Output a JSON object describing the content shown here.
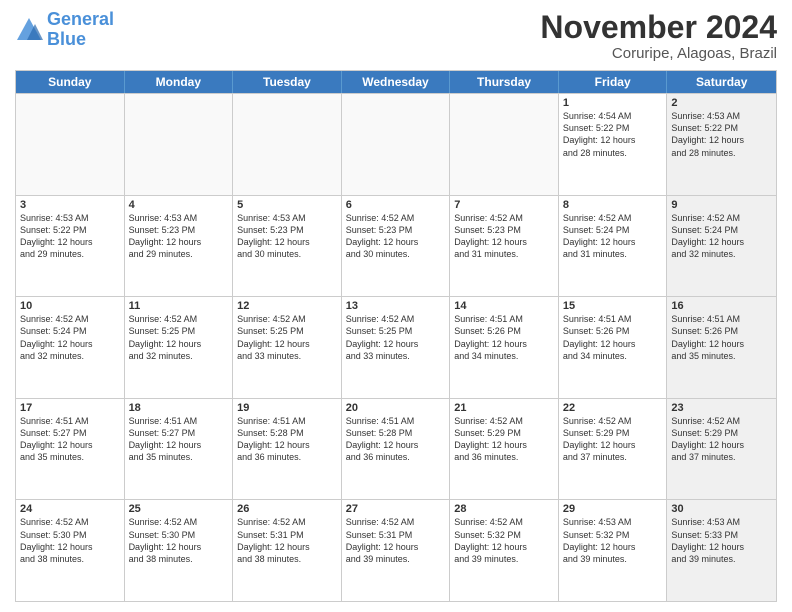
{
  "logo": {
    "line1": "General",
    "line2": "Blue"
  },
  "title": "November 2024",
  "location": "Coruripe, Alagoas, Brazil",
  "weekdays": [
    "Sunday",
    "Monday",
    "Tuesday",
    "Wednesday",
    "Thursday",
    "Friday",
    "Saturday"
  ],
  "rows": [
    [
      {
        "num": "",
        "info": "",
        "empty": true
      },
      {
        "num": "",
        "info": "",
        "empty": true
      },
      {
        "num": "",
        "info": "",
        "empty": true
      },
      {
        "num": "",
        "info": "",
        "empty": true
      },
      {
        "num": "",
        "info": "",
        "empty": true
      },
      {
        "num": "1",
        "info": "Sunrise: 4:54 AM\nSunset: 5:22 PM\nDaylight: 12 hours\nand 28 minutes.",
        "shade": false
      },
      {
        "num": "2",
        "info": "Sunrise: 4:53 AM\nSunset: 5:22 PM\nDaylight: 12 hours\nand 28 minutes.",
        "shade": true
      }
    ],
    [
      {
        "num": "3",
        "info": "Sunrise: 4:53 AM\nSunset: 5:22 PM\nDaylight: 12 hours\nand 29 minutes.",
        "shade": false
      },
      {
        "num": "4",
        "info": "Sunrise: 4:53 AM\nSunset: 5:23 PM\nDaylight: 12 hours\nand 29 minutes.",
        "shade": false
      },
      {
        "num": "5",
        "info": "Sunrise: 4:53 AM\nSunset: 5:23 PM\nDaylight: 12 hours\nand 30 minutes.",
        "shade": false
      },
      {
        "num": "6",
        "info": "Sunrise: 4:52 AM\nSunset: 5:23 PM\nDaylight: 12 hours\nand 30 minutes.",
        "shade": false
      },
      {
        "num": "7",
        "info": "Sunrise: 4:52 AM\nSunset: 5:23 PM\nDaylight: 12 hours\nand 31 minutes.",
        "shade": false
      },
      {
        "num": "8",
        "info": "Sunrise: 4:52 AM\nSunset: 5:24 PM\nDaylight: 12 hours\nand 31 minutes.",
        "shade": false
      },
      {
        "num": "9",
        "info": "Sunrise: 4:52 AM\nSunset: 5:24 PM\nDaylight: 12 hours\nand 32 minutes.",
        "shade": true
      }
    ],
    [
      {
        "num": "10",
        "info": "Sunrise: 4:52 AM\nSunset: 5:24 PM\nDaylight: 12 hours\nand 32 minutes.",
        "shade": false
      },
      {
        "num": "11",
        "info": "Sunrise: 4:52 AM\nSunset: 5:25 PM\nDaylight: 12 hours\nand 32 minutes.",
        "shade": false
      },
      {
        "num": "12",
        "info": "Sunrise: 4:52 AM\nSunset: 5:25 PM\nDaylight: 12 hours\nand 33 minutes.",
        "shade": false
      },
      {
        "num": "13",
        "info": "Sunrise: 4:52 AM\nSunset: 5:25 PM\nDaylight: 12 hours\nand 33 minutes.",
        "shade": false
      },
      {
        "num": "14",
        "info": "Sunrise: 4:51 AM\nSunset: 5:26 PM\nDaylight: 12 hours\nand 34 minutes.",
        "shade": false
      },
      {
        "num": "15",
        "info": "Sunrise: 4:51 AM\nSunset: 5:26 PM\nDaylight: 12 hours\nand 34 minutes.",
        "shade": false
      },
      {
        "num": "16",
        "info": "Sunrise: 4:51 AM\nSunset: 5:26 PM\nDaylight: 12 hours\nand 35 minutes.",
        "shade": true
      }
    ],
    [
      {
        "num": "17",
        "info": "Sunrise: 4:51 AM\nSunset: 5:27 PM\nDaylight: 12 hours\nand 35 minutes.",
        "shade": false
      },
      {
        "num": "18",
        "info": "Sunrise: 4:51 AM\nSunset: 5:27 PM\nDaylight: 12 hours\nand 35 minutes.",
        "shade": false
      },
      {
        "num": "19",
        "info": "Sunrise: 4:51 AM\nSunset: 5:28 PM\nDaylight: 12 hours\nand 36 minutes.",
        "shade": false
      },
      {
        "num": "20",
        "info": "Sunrise: 4:51 AM\nSunset: 5:28 PM\nDaylight: 12 hours\nand 36 minutes.",
        "shade": false
      },
      {
        "num": "21",
        "info": "Sunrise: 4:52 AM\nSunset: 5:29 PM\nDaylight: 12 hours\nand 36 minutes.",
        "shade": false
      },
      {
        "num": "22",
        "info": "Sunrise: 4:52 AM\nSunset: 5:29 PM\nDaylight: 12 hours\nand 37 minutes.",
        "shade": false
      },
      {
        "num": "23",
        "info": "Sunrise: 4:52 AM\nSunset: 5:29 PM\nDaylight: 12 hours\nand 37 minutes.",
        "shade": true
      }
    ],
    [
      {
        "num": "24",
        "info": "Sunrise: 4:52 AM\nSunset: 5:30 PM\nDaylight: 12 hours\nand 38 minutes.",
        "shade": false
      },
      {
        "num": "25",
        "info": "Sunrise: 4:52 AM\nSunset: 5:30 PM\nDaylight: 12 hours\nand 38 minutes.",
        "shade": false
      },
      {
        "num": "26",
        "info": "Sunrise: 4:52 AM\nSunset: 5:31 PM\nDaylight: 12 hours\nand 38 minutes.",
        "shade": false
      },
      {
        "num": "27",
        "info": "Sunrise: 4:52 AM\nSunset: 5:31 PM\nDaylight: 12 hours\nand 39 minutes.",
        "shade": false
      },
      {
        "num": "28",
        "info": "Sunrise: 4:52 AM\nSunset: 5:32 PM\nDaylight: 12 hours\nand 39 minutes.",
        "shade": false
      },
      {
        "num": "29",
        "info": "Sunrise: 4:53 AM\nSunset: 5:32 PM\nDaylight: 12 hours\nand 39 minutes.",
        "shade": false
      },
      {
        "num": "30",
        "info": "Sunrise: 4:53 AM\nSunset: 5:33 PM\nDaylight: 12 hours\nand 39 minutes.",
        "shade": true
      }
    ]
  ]
}
